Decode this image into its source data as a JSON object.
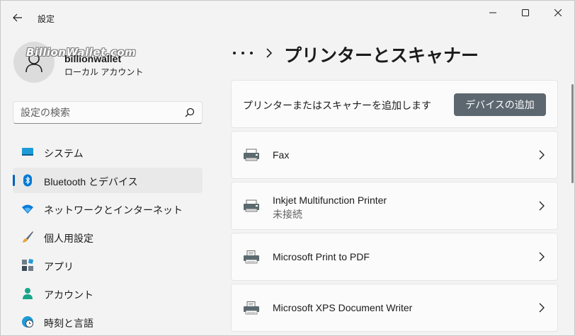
{
  "window": {
    "title": "設定",
    "watermark": "BillionWallet.com"
  },
  "profile": {
    "name": "billionwallet",
    "account_type": "ローカル アカウント"
  },
  "search": {
    "placeholder": "設定の検索"
  },
  "sidebar": {
    "items": [
      {
        "label": "システム",
        "icon": "system-icon"
      },
      {
        "label": "Bluetooth とデバイス",
        "icon": "bluetooth-icon",
        "active": true
      },
      {
        "label": "ネットワークとインターネット",
        "icon": "wifi-icon"
      },
      {
        "label": "個人用設定",
        "icon": "brush-icon"
      },
      {
        "label": "アプリ",
        "icon": "apps-icon"
      },
      {
        "label": "アカウント",
        "icon": "account-icon"
      },
      {
        "label": "時刻と言語",
        "icon": "clock-globe-icon"
      }
    ]
  },
  "main": {
    "page_title": "プリンターとスキャナー",
    "add_section": {
      "text": "プリンターまたはスキャナーを追加します",
      "button_label": "デバイスの追加"
    },
    "printers": [
      {
        "name": "Fax",
        "status": ""
      },
      {
        "name": "Inkjet Multifunction Printer",
        "status": "未接続"
      },
      {
        "name": "Microsoft Print to PDF",
        "status": ""
      },
      {
        "name": "Microsoft XPS Document Writer",
        "status": ""
      }
    ]
  },
  "colors": {
    "accent": "#005fb8",
    "button": "#5c6770"
  }
}
